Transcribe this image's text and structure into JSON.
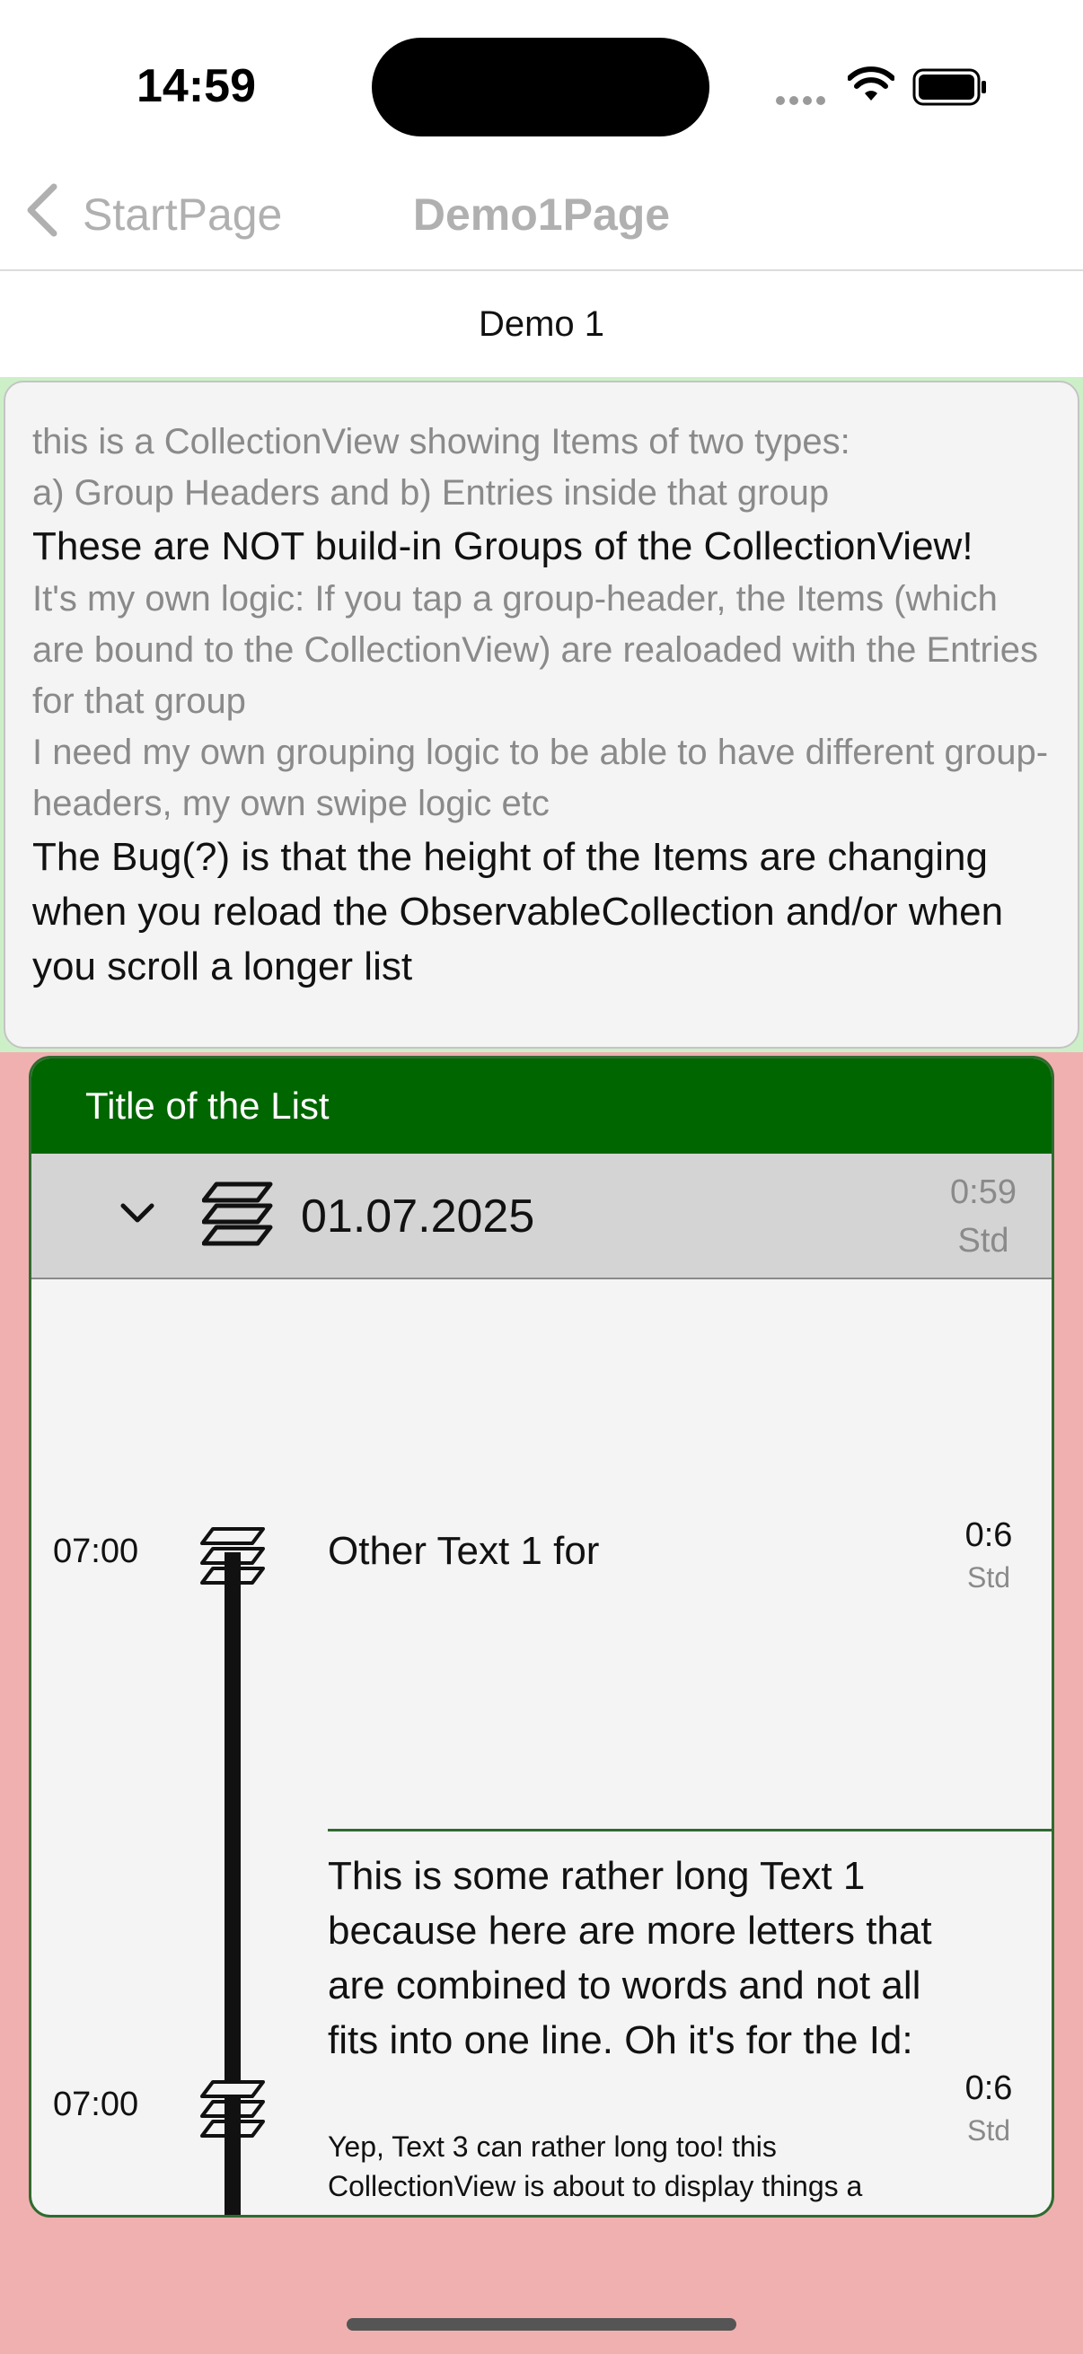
{
  "status_bar": {
    "time": "14:59"
  },
  "nav": {
    "back_label": "StartPage",
    "title": "Demo1Page"
  },
  "subheader": {
    "title": "Demo 1"
  },
  "description": {
    "line1": "this is a CollectionView showing Items of two types:",
    "line2": "a) Group Headers and b) Entries inside that group",
    "line3": "These are NOT build-in Groups of the CollectionView!",
    "line4": "It's my own logic: If you tap a group-header, the Items (which are bound to the CollectionView) are realoaded with the Entries for that group",
    "line5": "I need my own grouping logic to be able to have different group-headers, my own swipe logic etc",
    "line6": "The Bug(?) is that the height of the Items are changing when you reload the ObservableCollection and/or when you scroll a longer list"
  },
  "list": {
    "title": "Title of the List",
    "group": {
      "date": "01.07.2025",
      "duration_value": "0:59",
      "duration_unit": "Std"
    },
    "entries": [
      {
        "time": "07:00",
        "text": "Other Text 1 for",
        "duration_value": "0:6",
        "duration_unit": "Std"
      },
      {
        "time": "07:00",
        "text": "This is some rather long Text 1 because here are more letters that are combined to words and not all fits into one line. Oh it's for the Id:",
        "subtext": "Yep, Text 3 can rather long too! this CollectionView is about to display things a",
        "duration_value": "0:6",
        "duration_unit": "Std"
      }
    ]
  },
  "colors": {
    "list_header": "#006600",
    "page_background": "#f0b0b0",
    "description_frame": "#cdefc8"
  },
  "icons": [
    "back-chevron-icon",
    "wifi-icon",
    "battery-icon",
    "chevron-down-icon",
    "layers-icon"
  ]
}
